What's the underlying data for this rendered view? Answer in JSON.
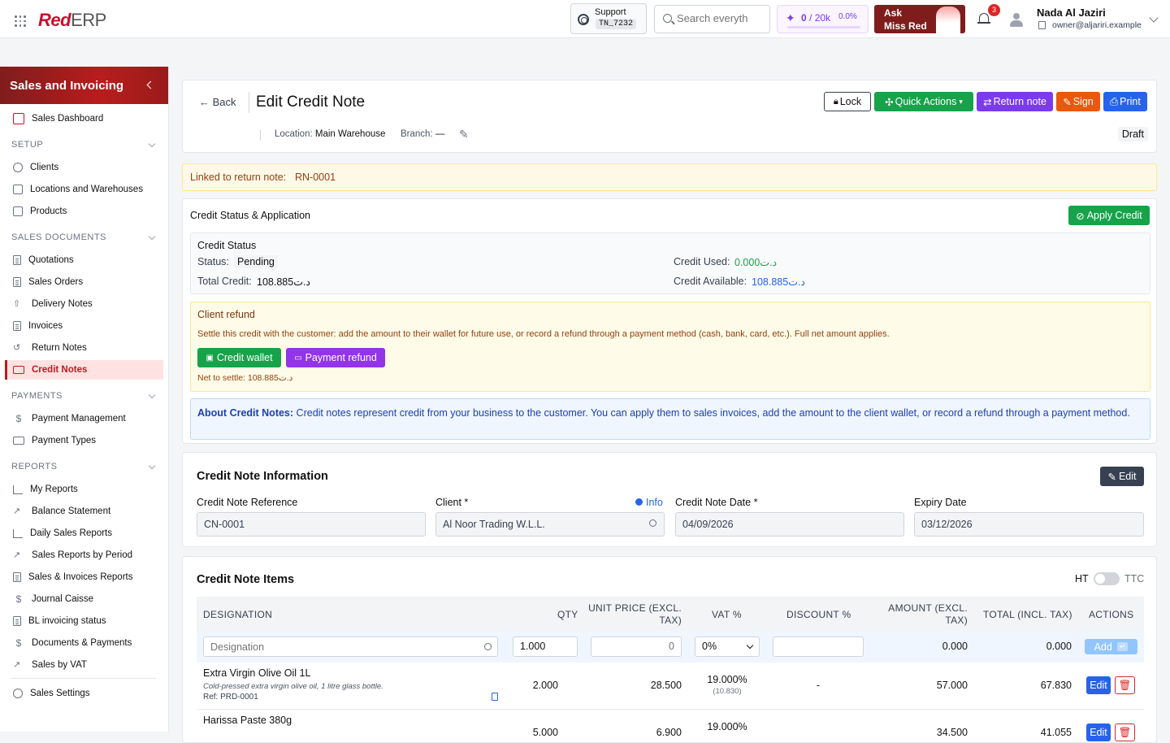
{
  "app": {
    "logo_a": "Red",
    "logo_b": "ERP"
  },
  "topbar": {
    "support_label": "Support",
    "support_code": "TN_7232",
    "search_placeholder": "Search everyth",
    "credits_count": "0",
    "credits_total": "/ 20k",
    "credits_pct": "0.0%",
    "ask_line1": "Ask",
    "ask_line2": "Miss Red",
    "notifications": "3",
    "user_name": "Nada Al Jaziri",
    "user_email": "owner@aljariri.example"
  },
  "sidebar": {
    "title": "Sales and Invoicing",
    "dashboard": "Sales Dashboard",
    "sections": {
      "setup": "SETUP",
      "sales_documents": "SALES DOCUMENTS",
      "payments": "PAYMENTS",
      "reports": "REPORTS"
    },
    "setup_items": [
      "Clients",
      "Locations and Warehouses",
      "Products"
    ],
    "doc_items": [
      "Quotations",
      "Sales Orders",
      "Delivery Notes",
      "Invoices",
      "Return Notes",
      "Credit Notes"
    ],
    "payment_items": [
      "Payment Management",
      "Payment Types"
    ],
    "report_items": [
      "My Reports",
      "Balance Statement",
      "Daily Sales Reports",
      "Sales Reports by Period",
      "Sales & Invoices Reports",
      "Journal Caisse",
      "BL invoicing status",
      "Documents & Payments",
      "Sales by VAT"
    ],
    "settings": "Sales Settings"
  },
  "header": {
    "back": "Back",
    "title": "Edit Credit Note",
    "location_label": "Location:",
    "location_value": "Main Warehouse",
    "branch_label": "Branch:",
    "branch_value": "—",
    "status": "Draft",
    "buttons": {
      "lock": "Lock",
      "quick_actions": "Quick Actions",
      "return_note": "Return note",
      "sign": "Sign",
      "print": "Print"
    }
  },
  "linked": {
    "label": "Linked to return note:",
    "value": "RN-0001"
  },
  "credit_status": {
    "section_title": "Credit Status & Application",
    "apply_button": "Apply Credit",
    "box_title": "Credit Status",
    "status_label": "Status:",
    "status_value": "Pending",
    "total_label": "Total Credit:",
    "total_value": "108.885د.ت",
    "used_label": "Credit Used:",
    "used_value": "0.000د.ت",
    "available_label": "Credit Available:",
    "available_value": "108.885د.ت"
  },
  "refund": {
    "title": "Client refund",
    "description": "Settle this credit with the customer: add the amount to their wallet for future use, or record a refund through a payment method (cash, bank, card, etc.). Full net amount applies.",
    "wallet_button": "Credit wallet",
    "payment_button": "Payment refund",
    "net_label": "Net to settle:",
    "net_value": "108.885د.ت"
  },
  "about": {
    "label": "About Credit Notes:",
    "text": "Credit notes represent credit from your business to the customer. You can apply them to sales invoices, add the amount to the client wallet, or record a refund through a payment method."
  },
  "info_card": {
    "title": "Credit Note Information",
    "edit_button": "Edit",
    "fields": {
      "reference_label": "Credit Note Reference",
      "reference_value": "CN-0001",
      "client_label": "Client *",
      "client_info": "Info",
      "client_value": "Al Noor Trading W.L.L.",
      "date_label": "Credit Note Date *",
      "date_value": "04/09/2026",
      "expiry_label": "Expiry Date",
      "expiry_value": "03/12/2026"
    }
  },
  "items": {
    "title": "Credit Note Items",
    "toggle_ht": "HT",
    "toggle_ttc": "TTC",
    "columns": [
      "DESIGNATION",
      "QTY",
      "UNIT PRICE (EXCL. TAX)",
      "VAT %",
      "DISCOUNT %",
      "AMOUNT (EXCL. TAX)",
      "TOTAL (INCL. TAX)",
      "ACTIONS"
    ],
    "new_row": {
      "designation_placeholder": "Designation",
      "qty": "1.000",
      "price": "0",
      "vat": "0%",
      "amount": "0.000",
      "total": "0.000",
      "add_button": "Add"
    },
    "rows": [
      {
        "name": "Extra Virgin Olive Oil 1L",
        "desc": "Cold-pressed extra virgin olive oil, 1 litre glass bottle.",
        "ref": "Ref: PRD-0001",
        "qty": "2.000",
        "price": "28.500",
        "vat": "19.000%",
        "vat_amount": "(10.830)",
        "discount": "-",
        "amount": "57.000",
        "total": "67.830",
        "edit": "Edit"
      },
      {
        "name": "Harissa Paste 380g",
        "desc": "",
        "ref": "",
        "qty": "5.000",
        "price": "6.900",
        "vat": "19.000%",
        "vat_amount": "",
        "discount": "",
        "amount": "34.500",
        "total": "41.055",
        "edit": "Edit"
      }
    ]
  },
  "colors": {
    "brand": "#c8102e",
    "green": "#16a34a",
    "purple": "#7c3aed",
    "orange": "#ea580c",
    "blue": "#2563eb"
  }
}
